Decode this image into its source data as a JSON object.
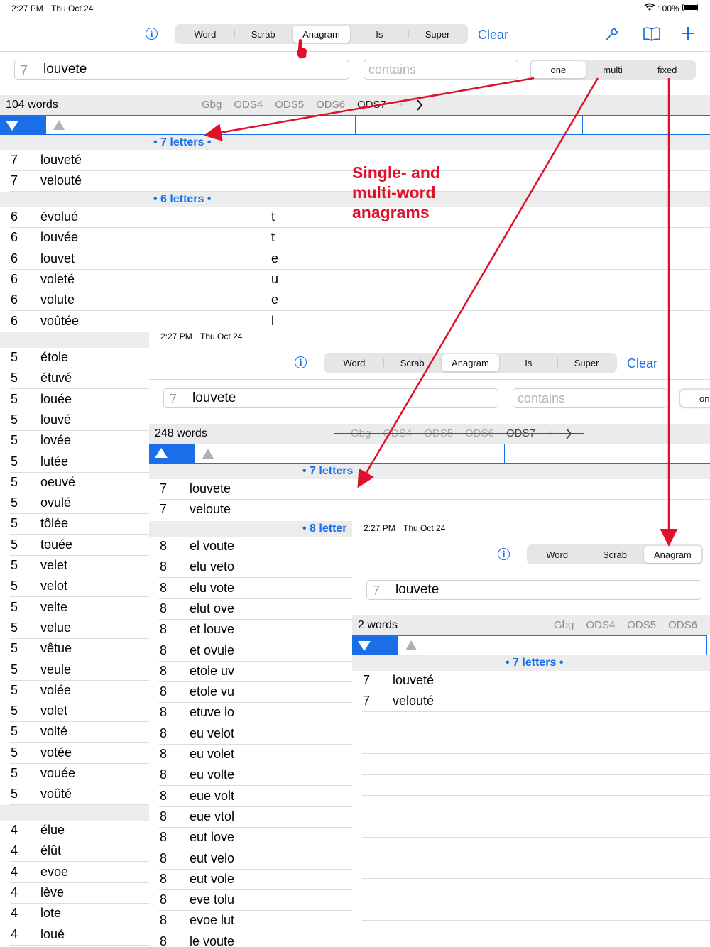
{
  "status": {
    "time": "2:27 PM",
    "date": "Thu Oct 24",
    "battery": "100%"
  },
  "accent": "#1a6fe8",
  "annotation_color": "#e0102a",
  "segments": [
    "Word",
    "Scrab",
    "Anagram",
    "Is",
    "Super"
  ],
  "selected_segment": "Anagram",
  "clear_label": "Clear",
  "search": {
    "length": "7",
    "value": "louvete",
    "contains_placeholder": "contains"
  },
  "mode_segments": [
    "one",
    "multi",
    "fixed"
  ],
  "annotation_text": "Single- and multi-word anagrams",
  "screen1": {
    "count": "104 words",
    "lists": [
      "Gbg",
      "ODS4",
      "ODS5",
      "ODS6",
      "ODS7",
      "+"
    ],
    "header7": "• 7 letters •",
    "header6": "• 6 letters •",
    "rows7": [
      [
        "7",
        "louveté"
      ],
      [
        "7",
        "velouté"
      ]
    ],
    "rows6": [
      [
        "6",
        "évolué",
        "t"
      ],
      [
        "6",
        "louvée",
        "t"
      ],
      [
        "6",
        "louvet",
        "e"
      ],
      [
        "6",
        "voleté",
        "u"
      ],
      [
        "6",
        "volute",
        "e"
      ],
      [
        "6",
        "voûtée",
        "l"
      ]
    ],
    "rows5": [
      [
        "5",
        "étole"
      ],
      [
        "5",
        "étuvé"
      ],
      [
        "5",
        "louée"
      ],
      [
        "5",
        "louvé"
      ],
      [
        "5",
        "lovée"
      ],
      [
        "5",
        "lutée"
      ],
      [
        "5",
        "oeuvé"
      ],
      [
        "5",
        "ovulé"
      ],
      [
        "5",
        "tôlée"
      ],
      [
        "5",
        "touée"
      ],
      [
        "5",
        "velet"
      ],
      [
        "5",
        "velot"
      ],
      [
        "5",
        "velte"
      ],
      [
        "5",
        "velue"
      ],
      [
        "5",
        "vêtue"
      ],
      [
        "5",
        "veule"
      ],
      [
        "5",
        "volée"
      ],
      [
        "5",
        "volet"
      ],
      [
        "5",
        "volté"
      ],
      [
        "5",
        "votée"
      ],
      [
        "5",
        "vouée"
      ],
      [
        "5",
        "voûté"
      ]
    ],
    "rows4": [
      [
        "4",
        "élue"
      ],
      [
        "4",
        "élût"
      ],
      [
        "4",
        "evoe"
      ],
      [
        "4",
        "lève"
      ],
      [
        "4",
        "lote"
      ],
      [
        "4",
        "loué"
      ]
    ]
  },
  "screen2": {
    "count": "248 words",
    "lists": [
      "Gbg",
      "ODS4",
      "ODS5",
      "ODS6",
      "ODS7",
      "+"
    ],
    "mode_partial": "on",
    "header7": "• 7 letters",
    "header8": "• 8 letter",
    "rows7": [
      [
        "7",
        "louvete"
      ],
      [
        "7",
        "veloute"
      ]
    ],
    "rows8": [
      [
        "8",
        "el voute"
      ],
      [
        "8",
        "elu veto"
      ],
      [
        "8",
        "elu vote"
      ],
      [
        "8",
        "elut ove"
      ],
      [
        "8",
        "et louve"
      ],
      [
        "8",
        "et ovule"
      ],
      [
        "8",
        "etole uv"
      ],
      [
        "8",
        "etole vu"
      ],
      [
        "8",
        "etuve lo"
      ],
      [
        "8",
        "eu velot"
      ],
      [
        "8",
        "eu volet"
      ],
      [
        "8",
        "eu volte"
      ],
      [
        "8",
        "eue volt"
      ],
      [
        "8",
        "eue vtol"
      ],
      [
        "8",
        "eut love"
      ],
      [
        "8",
        "eut velo"
      ],
      [
        "8",
        "eut vole"
      ],
      [
        "8",
        "eve tolu"
      ],
      [
        "8",
        "evoe lut"
      ],
      [
        "8",
        "le voute"
      ]
    ]
  },
  "screen3": {
    "count": "2 words",
    "lists": [
      "Gbg",
      "ODS4",
      "ODS5",
      "ODS6"
    ],
    "segments": [
      "Word",
      "Scrab",
      "Anagram"
    ],
    "header7": "• 7 letters •",
    "rows7": [
      [
        "7",
        "louveté"
      ],
      [
        "7",
        "velouté"
      ]
    ]
  }
}
